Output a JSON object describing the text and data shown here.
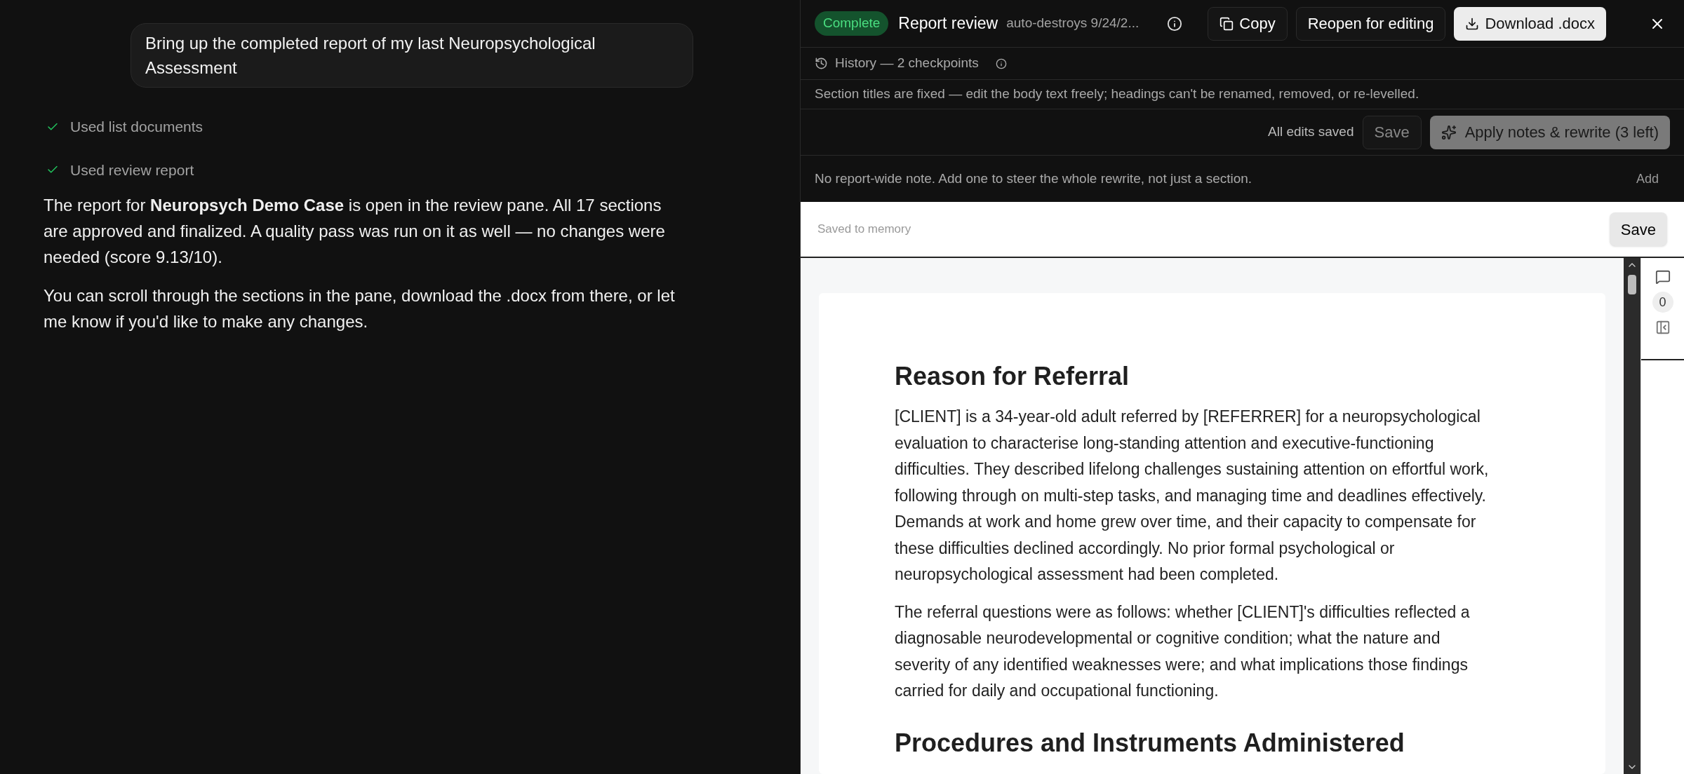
{
  "chat": {
    "user_message": "Bring up the completed report of my last Neuropsychological Assessment",
    "tool_calls": [
      {
        "label": "Used list documents"
      },
      {
        "label": "Used review report"
      }
    ],
    "assistant_paragraphs": [
      "The report for **Neuropsych Demo Case** is open in the review pane. All 17 sections are approved and finalized. A quality pass was run on it as well — no changes were needed (score 9.13/10).",
      "You can scroll through the sections in the pane, download the .docx from there, or let me know if you'd like to make any changes."
    ]
  },
  "review_pane": {
    "status_badge": "Complete",
    "title": "Report review",
    "subtitle": "auto-destroys 9/24/2...",
    "header_buttons": [
      {
        "label": "Copy",
        "kind": "copy"
      },
      {
        "label": "Reopen for editing",
        "kind": "plain"
      },
      {
        "label": "Download .docx",
        "kind": "download"
      }
    ],
    "history": "History — 2 checkpoints",
    "notice": "Section titles are fixed — edit the body text freely; headings can't be renamed, removed, or re-levelled.",
    "save_status": "All edits saved",
    "save_button": {
      "label": "Save",
      "disabled": true
    },
    "apply_button": {
      "label": "Apply notes & rewrite (3 left)",
      "disabled": true
    },
    "note_text": "No report-wide note. Add one to steer the whole rewrite, not just a section.",
    "note_add": "Add",
    "memory_field": {
      "placeholder": "Saved to memory"
    },
    "memory_save": "Save",
    "comment_count": "0",
    "document": {
      "sections": [
        {
          "heading": "Reason for Referral",
          "paragraphs": [
            "[CLIENT] is a 34-year-old adult referred by [REFERRER] for a neuropsychological evaluation to characterise long-standing attention and executive-functioning difficulties. They described lifelong challenges sustaining attention on effortful work, following through on multi-step tasks, and managing time and deadlines effectively. Demands at work and home grew over time, and their capacity to compensate for these difficulties declined accordingly. No prior formal psychological or neuropsychological assessment had been completed.",
            "The referral questions were as follows: whether [CLIENT]'s difficulties reflected a diagnosable neurodevelopmental or cognitive condition; what the nature and severity of any identified weaknesses were; and what implications those findings carried for daily and occupational functioning."
          ]
        },
        {
          "heading": "Procedures and Instruments Administered"
        }
      ]
    }
  }
}
